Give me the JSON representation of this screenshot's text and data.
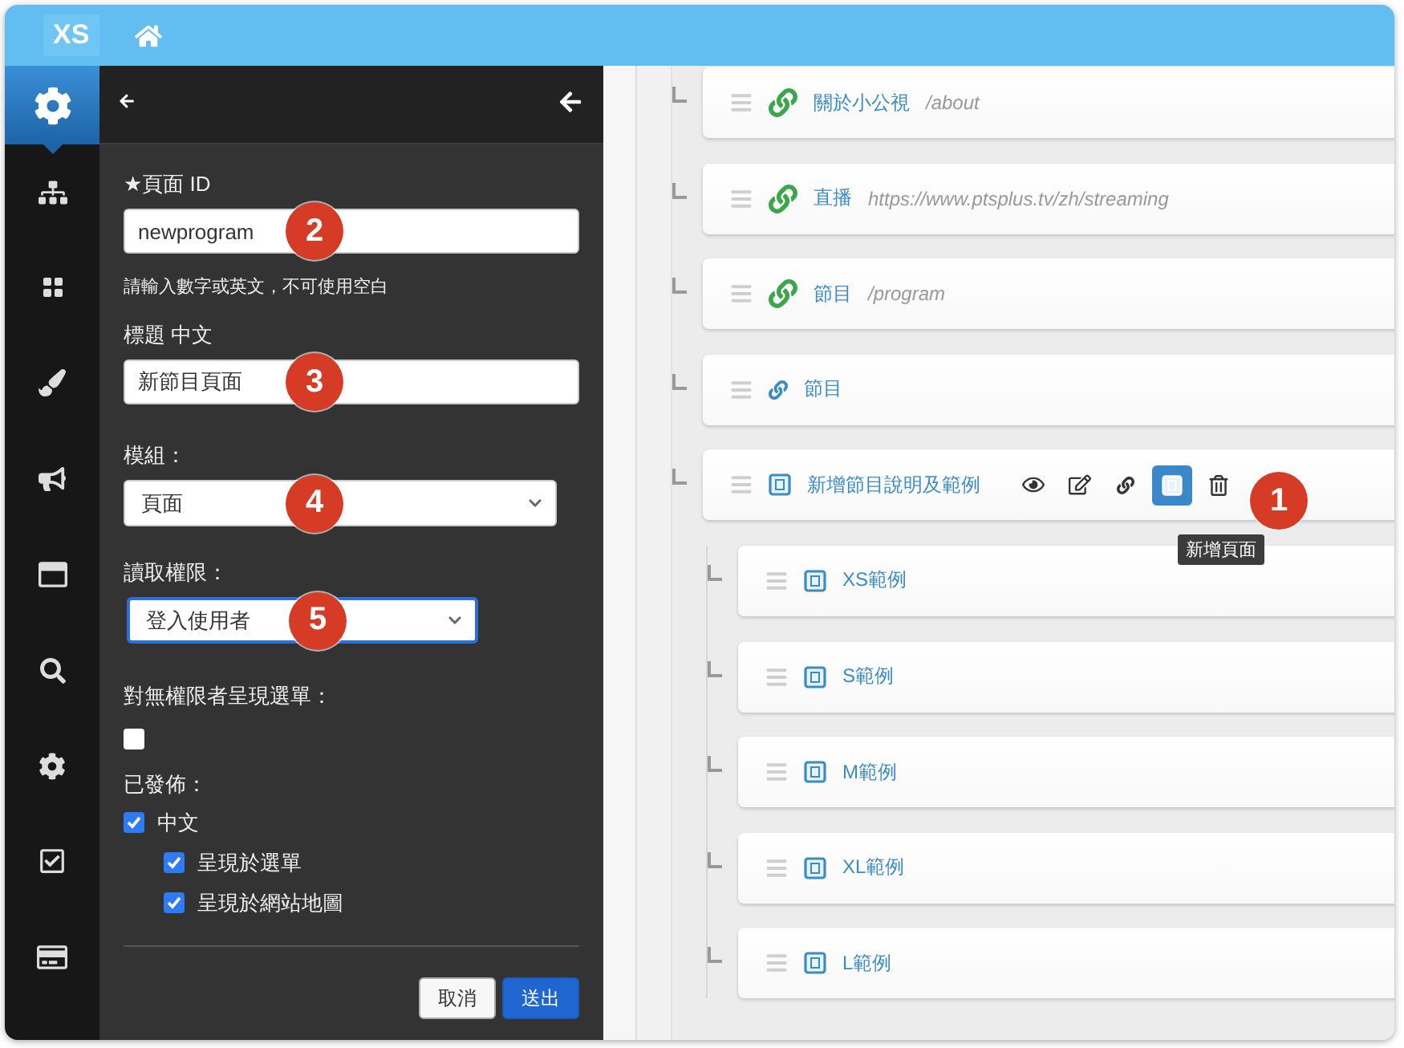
{
  "topbar": {
    "logo": "XS"
  },
  "rail": [
    {
      "kind": "settings",
      "selected": true
    },
    {
      "kind": "sitemap",
      "selected": false
    },
    {
      "kind": "apps",
      "selected": false
    },
    {
      "kind": "brush",
      "selected": false
    },
    {
      "kind": "megaphone",
      "selected": false
    },
    {
      "kind": "window",
      "selected": false
    },
    {
      "kind": "search",
      "selected": false
    },
    {
      "kind": "gear",
      "selected": false
    },
    {
      "kind": "checklist",
      "selected": false
    },
    {
      "kind": "card",
      "selected": false
    }
  ],
  "panel": {
    "fields": [
      {
        "kind": "text",
        "label": "★頁面 ID",
        "value": "newprogram",
        "hint": "請輸入數字或英文，不可使用空白",
        "callout": "2"
      },
      {
        "kind": "text",
        "label": "標題 中文",
        "value": "新節目頁面",
        "callout": "3"
      },
      {
        "kind": "select",
        "label": "模組：",
        "value": "頁面",
        "focused": false,
        "callout": "4"
      },
      {
        "kind": "select",
        "label": "讀取權限：",
        "value": "登入使用者",
        "focused": true,
        "callout": "5"
      },
      {
        "kind": "checkbox",
        "label": "對無權限者呈現選單：",
        "checked": false
      },
      {
        "kind": "checkgroup",
        "label": "已發佈：",
        "options": [
          {
            "label": "中文",
            "checked": true,
            "children": [
              {
                "label": "呈現於選單",
                "checked": true
              },
              {
                "label": "呈現於網站地圖",
                "checked": true
              }
            ]
          }
        ]
      }
    ],
    "buttons": [
      {
        "label": "取消",
        "kind": "secondary"
      },
      {
        "label": "送出",
        "kind": "primary"
      }
    ]
  },
  "tree": [
    {
      "kind": "external_link",
      "label": "關於小公視",
      "path": "/about"
    },
    {
      "kind": "external_link",
      "label": "直播",
      "path": "https://www.ptsplus.tv/zh/streaming"
    },
    {
      "kind": "external_link",
      "label": "節目",
      "path": "/program"
    },
    {
      "kind": "link",
      "label": "節目"
    },
    {
      "kind": "page",
      "label": "新增節目說明及範例",
      "callout": "1",
      "actions": [
        {
          "kind": "view",
          "selected": false
        },
        {
          "kind": "edit",
          "selected": false
        },
        {
          "kind": "link",
          "selected": false
        },
        {
          "kind": "add_page",
          "selected": true,
          "tooltip": "新增頁面"
        },
        {
          "kind": "delete",
          "selected": false
        }
      ],
      "children": [
        {
          "kind": "page",
          "label": "XS範例"
        },
        {
          "kind": "page",
          "label": "S範例"
        },
        {
          "kind": "page",
          "label": "M範例"
        },
        {
          "kind": "page",
          "label": "XL範例"
        },
        {
          "kind": "page",
          "label": "L範例"
        }
      ]
    }
  ]
}
